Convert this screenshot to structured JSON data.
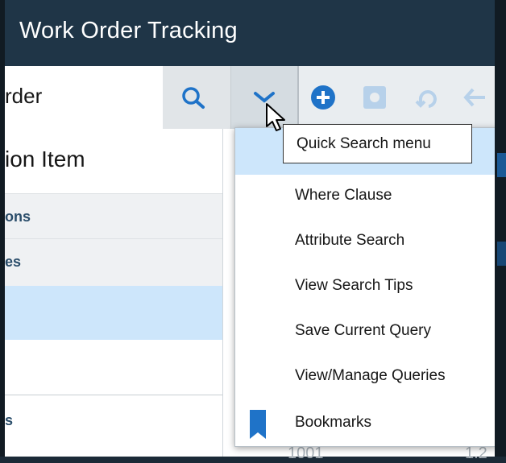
{
  "app": {
    "title": "Work Order Tracking"
  },
  "toolbar": {
    "search_value": "rder",
    "search_tooltip": "Quick Search menu"
  },
  "left_panel": {
    "section_title": "ion Item",
    "rows": [
      "ons",
      "es"
    ],
    "bottom_text": "s"
  },
  "menu": {
    "items": [
      "Where Clause",
      "Attribute Search",
      "View Search Tips",
      "Save Current Query",
      "View/Manage Queries",
      "Bookmarks"
    ]
  },
  "background": {
    "left_value": "1001",
    "right_value": "1.2"
  },
  "colors": {
    "header_bg": "#1f3547",
    "accent_blue": "#1f73c8",
    "selected_bg": "#cde6fb",
    "label_blue": "#2a4d6a"
  },
  "icons": [
    "search-icon",
    "chevron-down-icon",
    "add-icon",
    "record-icon",
    "undo-icon",
    "back-arrow-icon",
    "bookmark-icon",
    "mouse-cursor-icon"
  ]
}
